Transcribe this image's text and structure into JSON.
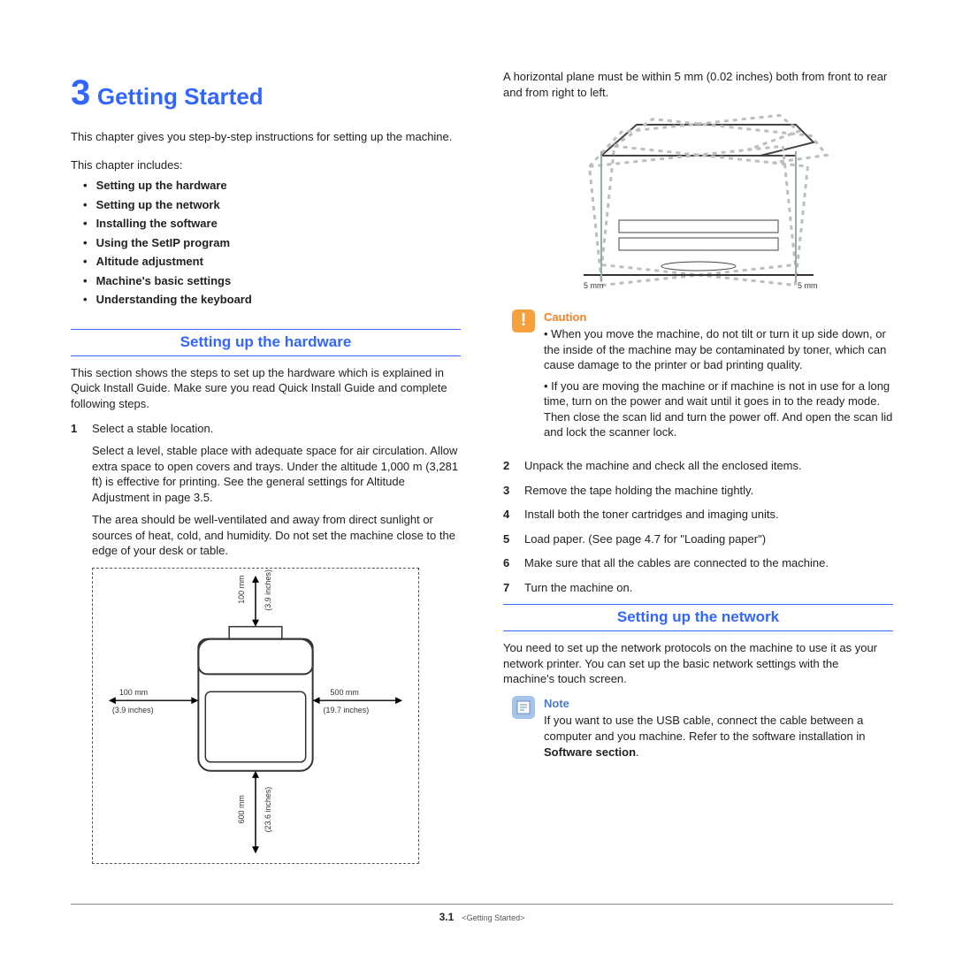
{
  "chapter": {
    "num": "3",
    "title": "Getting Started"
  },
  "intro": "This chapter gives you step-by-step instructions for setting up the machine.",
  "includes_label": "This chapter includes:",
  "toc": [
    "Setting up the hardware",
    "Setting up the network",
    "Installing the software",
    "Using the SetIP program",
    "Altitude adjustment",
    "Machine's basic settings",
    "Understanding the keyboard"
  ],
  "sec1": {
    "heading": "Setting up the hardware",
    "intro": "This section shows the steps to set up the hardware which is explained in Quick Install Guide. Make sure you read Quick Install Guide and complete following steps.",
    "step1_num": "1",
    "step1_text": "Select a stable location.",
    "step1_p1": "Select a level, stable place with adequate space for air circulation. Allow extra space to open covers and trays. Under the altitude 1,000 m (3,281 ft) is effective for printing. See the general settings for Altitude Adjustment in page 3.5.",
    "step1_p2": "The area should be well-ventilated and away from direct sunlight or sources of heat, cold, and humidity. Do not set the machine close to the edge of your desk or table.",
    "fig1": {
      "top_mm": "100 mm",
      "top_in": "(3.9 inches)",
      "left_mm": "100 mm",
      "left_in": "(3.9 inches)",
      "right_mm": "500 mm",
      "right_in": "(19.7 inches)",
      "bottom_mm": "600 mm",
      "bottom_in": "(23.6 inches)"
    }
  },
  "col2": {
    "hplane": "A horizontal plane must be within 5 mm (0.02 inches) both from front to rear and from right to left.",
    "fig2": {
      "left": "5 mm",
      "right": "5 mm"
    },
    "caution": {
      "label": "Caution",
      "b1": "When you move the machine, do not tilt or turn it up side down, or the inside of the machine may be contaminated by toner, which can cause damage to the printer or bad printing quality.",
      "b2": "If you are moving the machine or if machine is not in use for a long time, turn on the power and wait until it goes in to the ready mode. Then close the scan lid and turn the power off. And open the scan lid and lock the scanner lock."
    },
    "steps": {
      "n2": "2",
      "t2": "Unpack the machine and check all the enclosed items.",
      "n3": "3",
      "t3": "Remove the tape holding the machine tightly.",
      "n4": "4",
      "t4": "Install both the toner cartridges and imaging units.",
      "n5": "5",
      "t5": "Load paper. (See  page 4.7 for \"Loading paper\")",
      "n6": "6",
      "t6": "Make sure that all the cables are connected to the machine.",
      "n7": "7",
      "t7": "Turn the machine on."
    }
  },
  "sec2": {
    "heading": "Setting up the network",
    "intro": "You need to set up the network protocols on the machine to use it as your network printer. You can set up the basic network settings with the machine's touch screen.",
    "note": {
      "label": "Note",
      "text": "If you want to use the USB cable, connect the cable between a computer and you machine. Refer to the software installation in ",
      "bold": "Software section",
      "tail": "."
    }
  },
  "footer": {
    "page": "3.1",
    "crumb": "<Getting Started>"
  }
}
